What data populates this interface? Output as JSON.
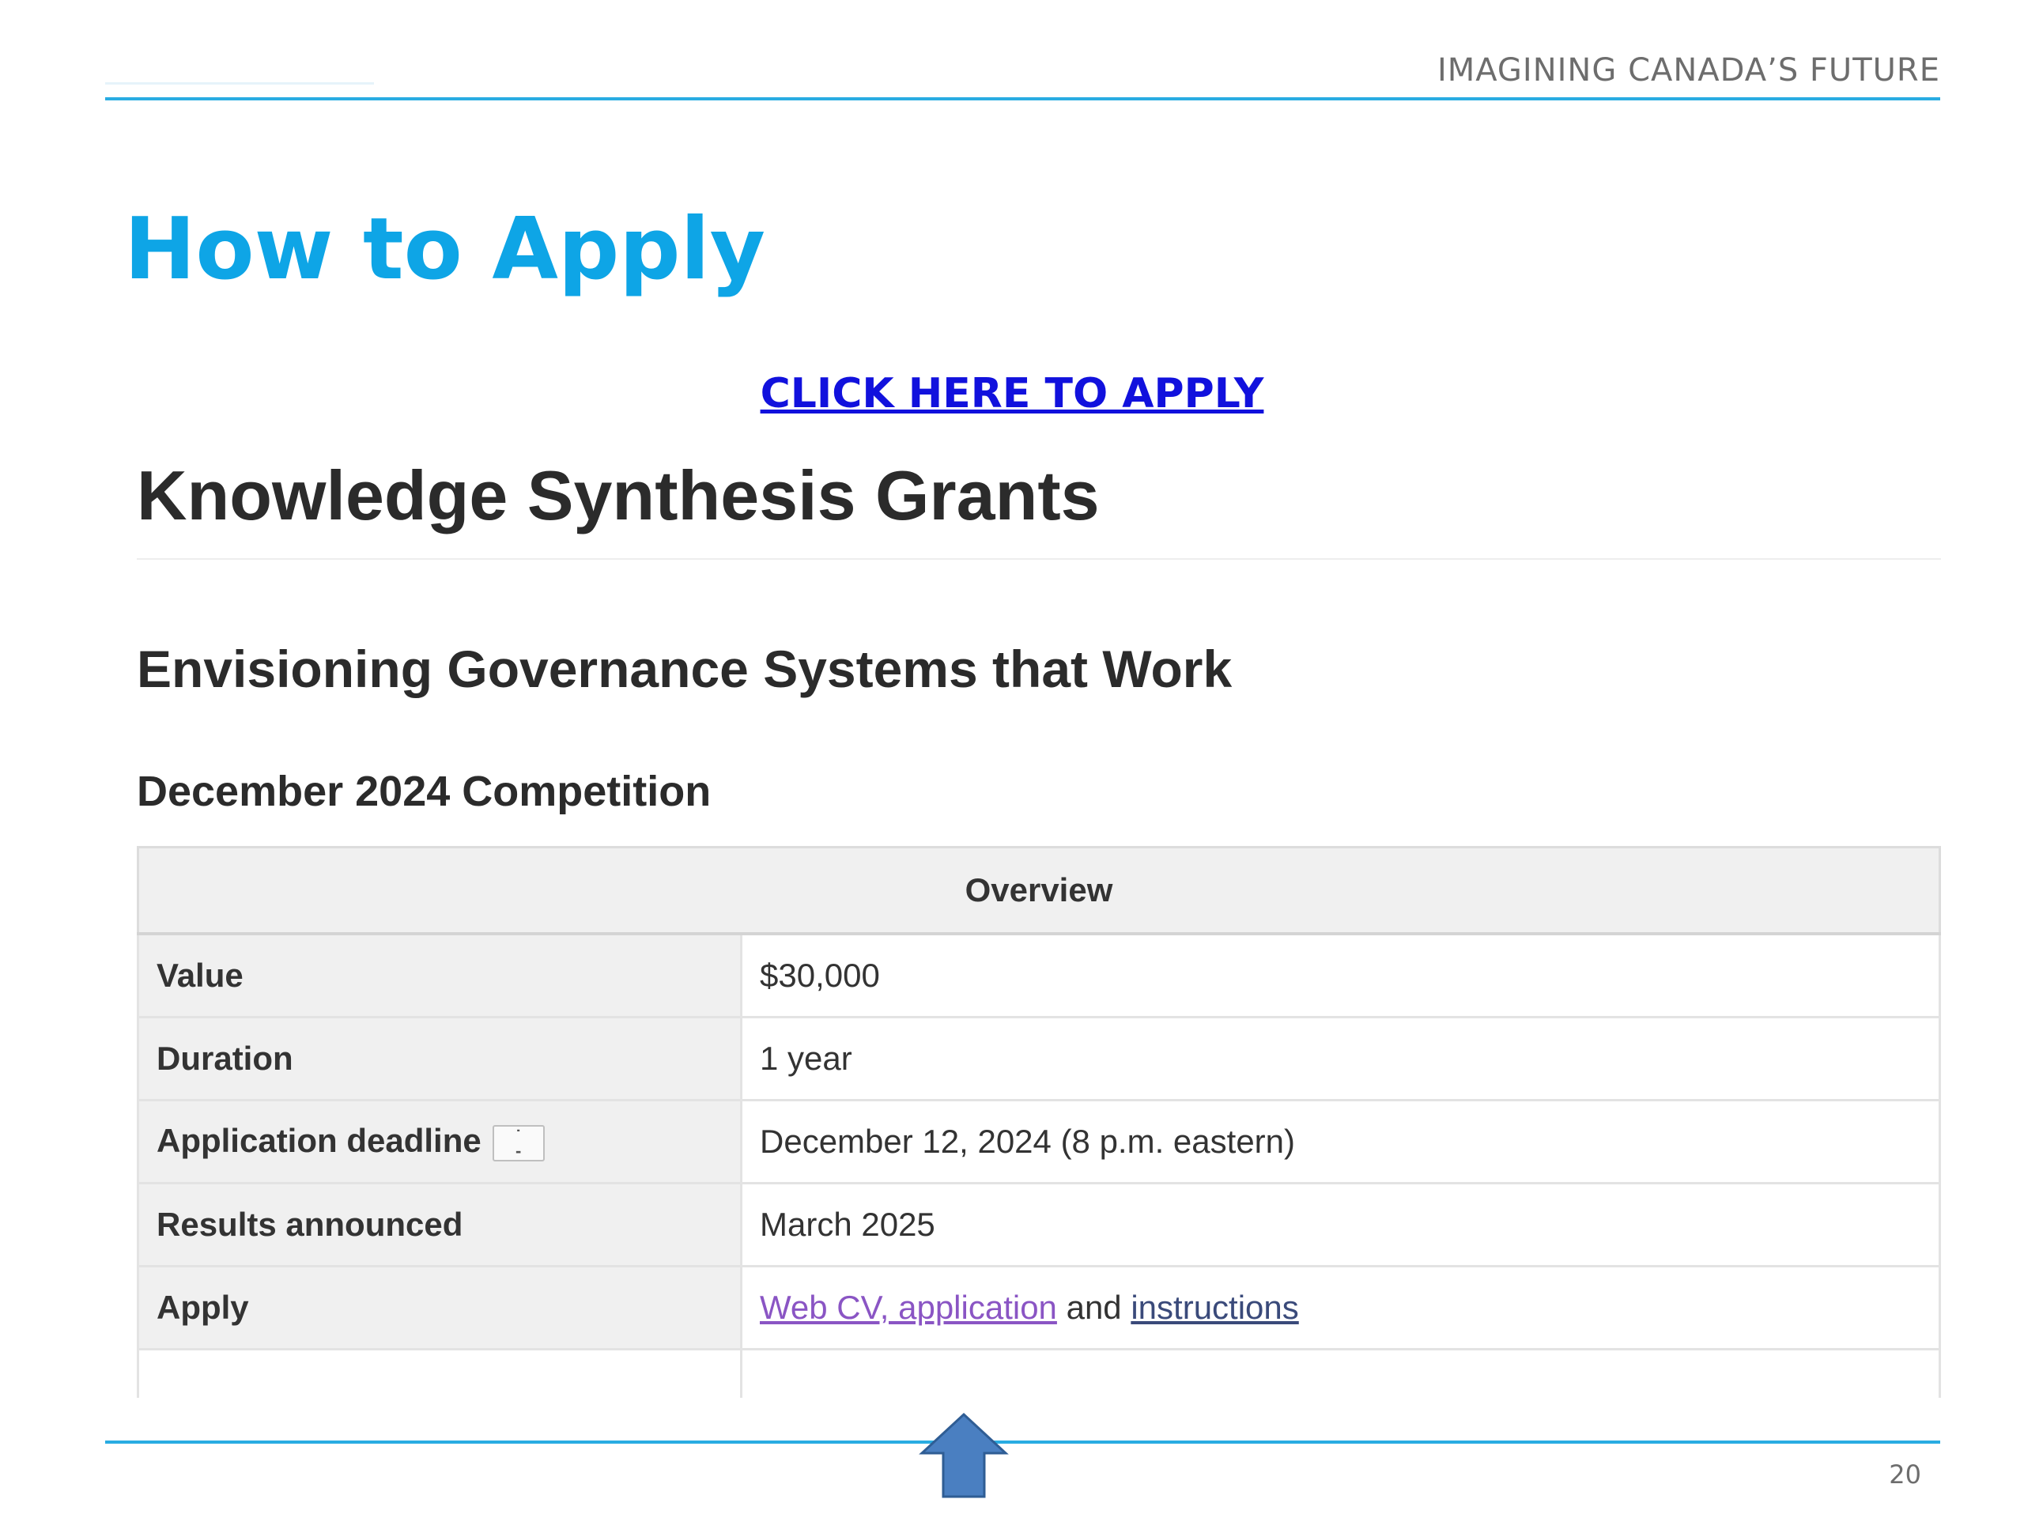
{
  "slide": {
    "header_text": "IMAGINING CANADA’S FUTURE",
    "title": "How to Apply",
    "apply_link": "CLICK HERE TO APPLY",
    "page_number": "20",
    "accent_color": "#29ace2",
    "title_color": "#0ea5e6",
    "arrow_icon": "up-arrow-icon"
  },
  "webpage": {
    "h1": "Knowledge Synthesis Grants",
    "h2": "Envisioning Governance Systems that Work",
    "h3": "December 2024 Competition",
    "table": {
      "caption": "Overview",
      "rows": [
        {
          "key": "Value",
          "value": "$30,000"
        },
        {
          "key": "Duration",
          "value": "1 year"
        },
        {
          "key": "Application deadline",
          "value": "December 12, 2024 (8 p.m. eastern)"
        },
        {
          "key": "Results announced",
          "value": "March 2025"
        },
        {
          "key": "Apply",
          "value_link1": "Web CV, application",
          "value_text": " and ",
          "value_link2": "instructions"
        }
      ]
    }
  }
}
